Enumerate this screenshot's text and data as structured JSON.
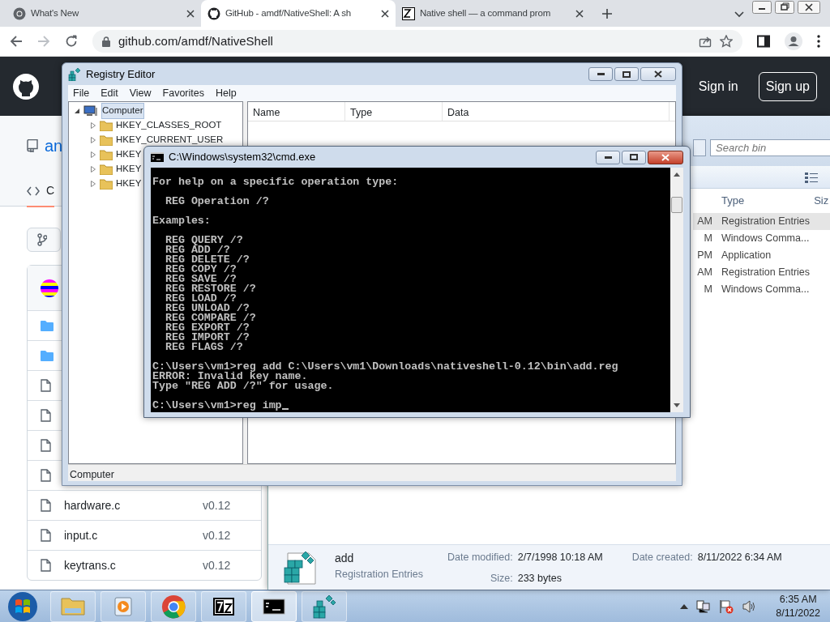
{
  "browser": {
    "tabs": [
      {
        "kind": "chrome",
        "title": "What's New",
        "selected": false
      },
      {
        "kind": "github",
        "title": "GitHub - amdf/NativeShell: A sh",
        "selected": true
      },
      {
        "kind": "zn",
        "title": "Native shell — a command prom",
        "selected": false
      }
    ],
    "url": "github.com/amdf/NativeShell"
  },
  "github": {
    "header_buttons": [
      {
        "kind": "plain",
        "label": "Sign in"
      },
      {
        "kind": "outline",
        "label": "Sign up"
      }
    ],
    "repo_title": "an",
    "repo_tab": "C",
    "files": [
      {
        "kind": "folder"
      },
      {
        "kind": "folder"
      },
      {
        "kind": "file"
      },
      {
        "kind": "file"
      },
      {
        "kind": "file"
      },
      {
        "kind": "file"
      },
      {
        "kind": "file",
        "name": "hardware.c",
        "version": "v0.12"
      },
      {
        "kind": "file",
        "name": "input.c",
        "version": "v0.12"
      },
      {
        "kind": "file",
        "name": "keytrans.c",
        "version": "v0.12"
      }
    ]
  },
  "explorer": {
    "search": {
      "placeholder": "Search bin"
    },
    "columns": [
      "Type",
      "Siz"
    ],
    "rows": [
      {
        "column_1": "AM",
        "type": "Registration Entries",
        "selected": true
      },
      {
        "column_1": "M",
        "type": "Windows Comma...",
        "selected": false
      },
      {
        "column_1": "PM",
        "type": "Application",
        "selected": false
      },
      {
        "column_1": "AM",
        "type": "Registration Entries",
        "selected": false
      },
      {
        "column_1": "M",
        "type": "Windows Comma...",
        "selected": false
      }
    ],
    "details": {
      "name": "add",
      "type": "Registration Entries",
      "fields": [
        {
          "label": "Date modified:",
          "value": "2/7/1998 10:18 AM"
        },
        {
          "label": "Date created:",
          "value": "8/11/2022 6:34 AM"
        },
        {
          "label": "Size:",
          "value": "233 bytes"
        }
      ]
    }
  },
  "registry_editor": {
    "title": "Registry Editor",
    "menu": [
      "File",
      "Edit",
      "View",
      "Favorites",
      "Help"
    ],
    "tree": [
      {
        "label": "Computer",
        "selected": true,
        "expanded": true,
        "children": [
          {
            "label": "HKEY_CLASSES_ROOT",
            "expanded": false
          },
          {
            "label": "HKEY_CURRENT_USER",
            "expanded": false
          },
          {
            "label": "HKEY",
            "expanded": false
          },
          {
            "label": "HKEY",
            "expanded": false
          },
          {
            "label": "HKEY",
            "expanded": false
          }
        ]
      }
    ],
    "columns": [
      "Name",
      "Type",
      "Data"
    ],
    "status_bar": "Computer"
  },
  "cmd": {
    "title": "C:\\Windows\\system32\\cmd.exe",
    "blocks": [
      [
        "For help on a specific operation type:"
      ],
      [
        "  REG Operation /?"
      ],
      [
        "Examples:"
      ],
      [
        "  REG QUERY /?",
        "  REG ADD /?",
        "  REG DELETE /?",
        "  REG COPY /?",
        "  REG SAVE /?",
        "  REG RESTORE /?",
        "  REG LOAD /?",
        "  REG UNLOAD /?",
        "  REG COMPARE /?",
        "  REG EXPORT /?",
        "  REG IMPORT /?",
        "  REG FLAGS /?"
      ],
      [
        "C:\\Users\\vm1>reg add C:\\Users\\vm1\\Downloads\\nativeshell-0.12\\bin\\add.reg",
        "ERROR: Invalid key name.",
        "Type \"REG ADD /?\" for usage."
      ],
      [
        "C:\\Users\\vm1>reg imp"
      ]
    ]
  },
  "taskbar": {
    "items": [
      {
        "kind": "folder",
        "selected": false
      },
      {
        "kind": "media",
        "selected": false
      },
      {
        "kind": "chrome",
        "selected": false
      },
      {
        "kind": "archive",
        "selected": false
      },
      {
        "kind": "cmd",
        "selected": true
      },
      {
        "kind": "regedit",
        "selected": false
      }
    ],
    "time": "6:35 AM",
    "date": "8/11/2022"
  }
}
